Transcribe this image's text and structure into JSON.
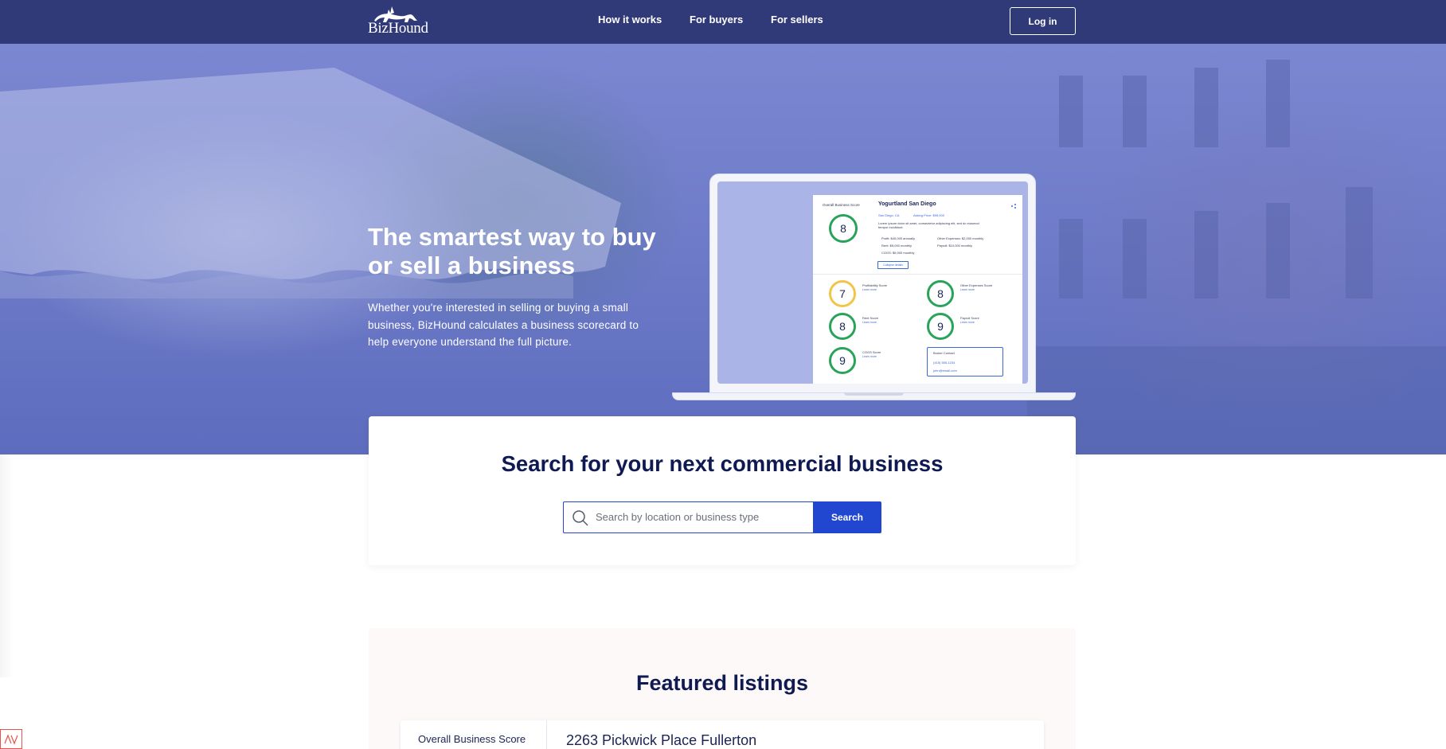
{
  "brand": {
    "name": "BizHound"
  },
  "nav": {
    "links": [
      "How it works",
      "For buyers",
      "For sellers"
    ],
    "login_label": "Log in"
  },
  "hero": {
    "title": "The smartest way to buy or sell a business",
    "subtitle": "Whether you're interested in selling or buying a small business, BizHound calculates a business scorecard to help everyone understand the full picture."
  },
  "preview_card": {
    "overall_label": "Overall Business Score",
    "overall_score": "8",
    "business_name": "Yogurtland San Diego",
    "location": "San Diego, CA",
    "asking_price": "Asking Price: $95,000",
    "description": "Lorem ipsum dolor sit amet, consectetur adipiscing elit, sed do eiusmod tempor incididunt.",
    "facts_left": [
      "Profit: $40,000 annually",
      "Rent: $5,000 monthly",
      "COGS: $5,000 monthly"
    ],
    "facts_right": [
      "Other Expenses: $2,000 monthly",
      "Payroll: $10,000 monthly"
    ],
    "collapse_label": "Collapse details",
    "learn_more": "Learn more",
    "scores": [
      {
        "label": "Profitability Score",
        "value": "7",
        "tone": "yellow"
      },
      {
        "label": "Other Expenses Score",
        "value": "8",
        "tone": "green"
      },
      {
        "label": "Rent Score",
        "value": "8",
        "tone": "green"
      },
      {
        "label": "Payroll Score",
        "value": "9",
        "tone": "green"
      },
      {
        "label": "COGS Score",
        "value": "9",
        "tone": "green"
      }
    ],
    "broker": {
      "title": "Broker Contact",
      "phone": "(415) 555-1234",
      "email": "john@email.com"
    }
  },
  "search": {
    "title": "Search for your next commercial business",
    "placeholder": "Search by location or business type",
    "button_label": "Search"
  },
  "featured": {
    "title": "Featured listings",
    "listing": {
      "score_label": "Overall Business Score",
      "name": "2263 Pickwick Place Fullerton"
    }
  },
  "colors": {
    "nav_bg": "#313a78",
    "primary": "#2147d1",
    "heading": "#0f1a52",
    "score_green": "#2aa35a",
    "score_yellow": "#f2c44a"
  }
}
